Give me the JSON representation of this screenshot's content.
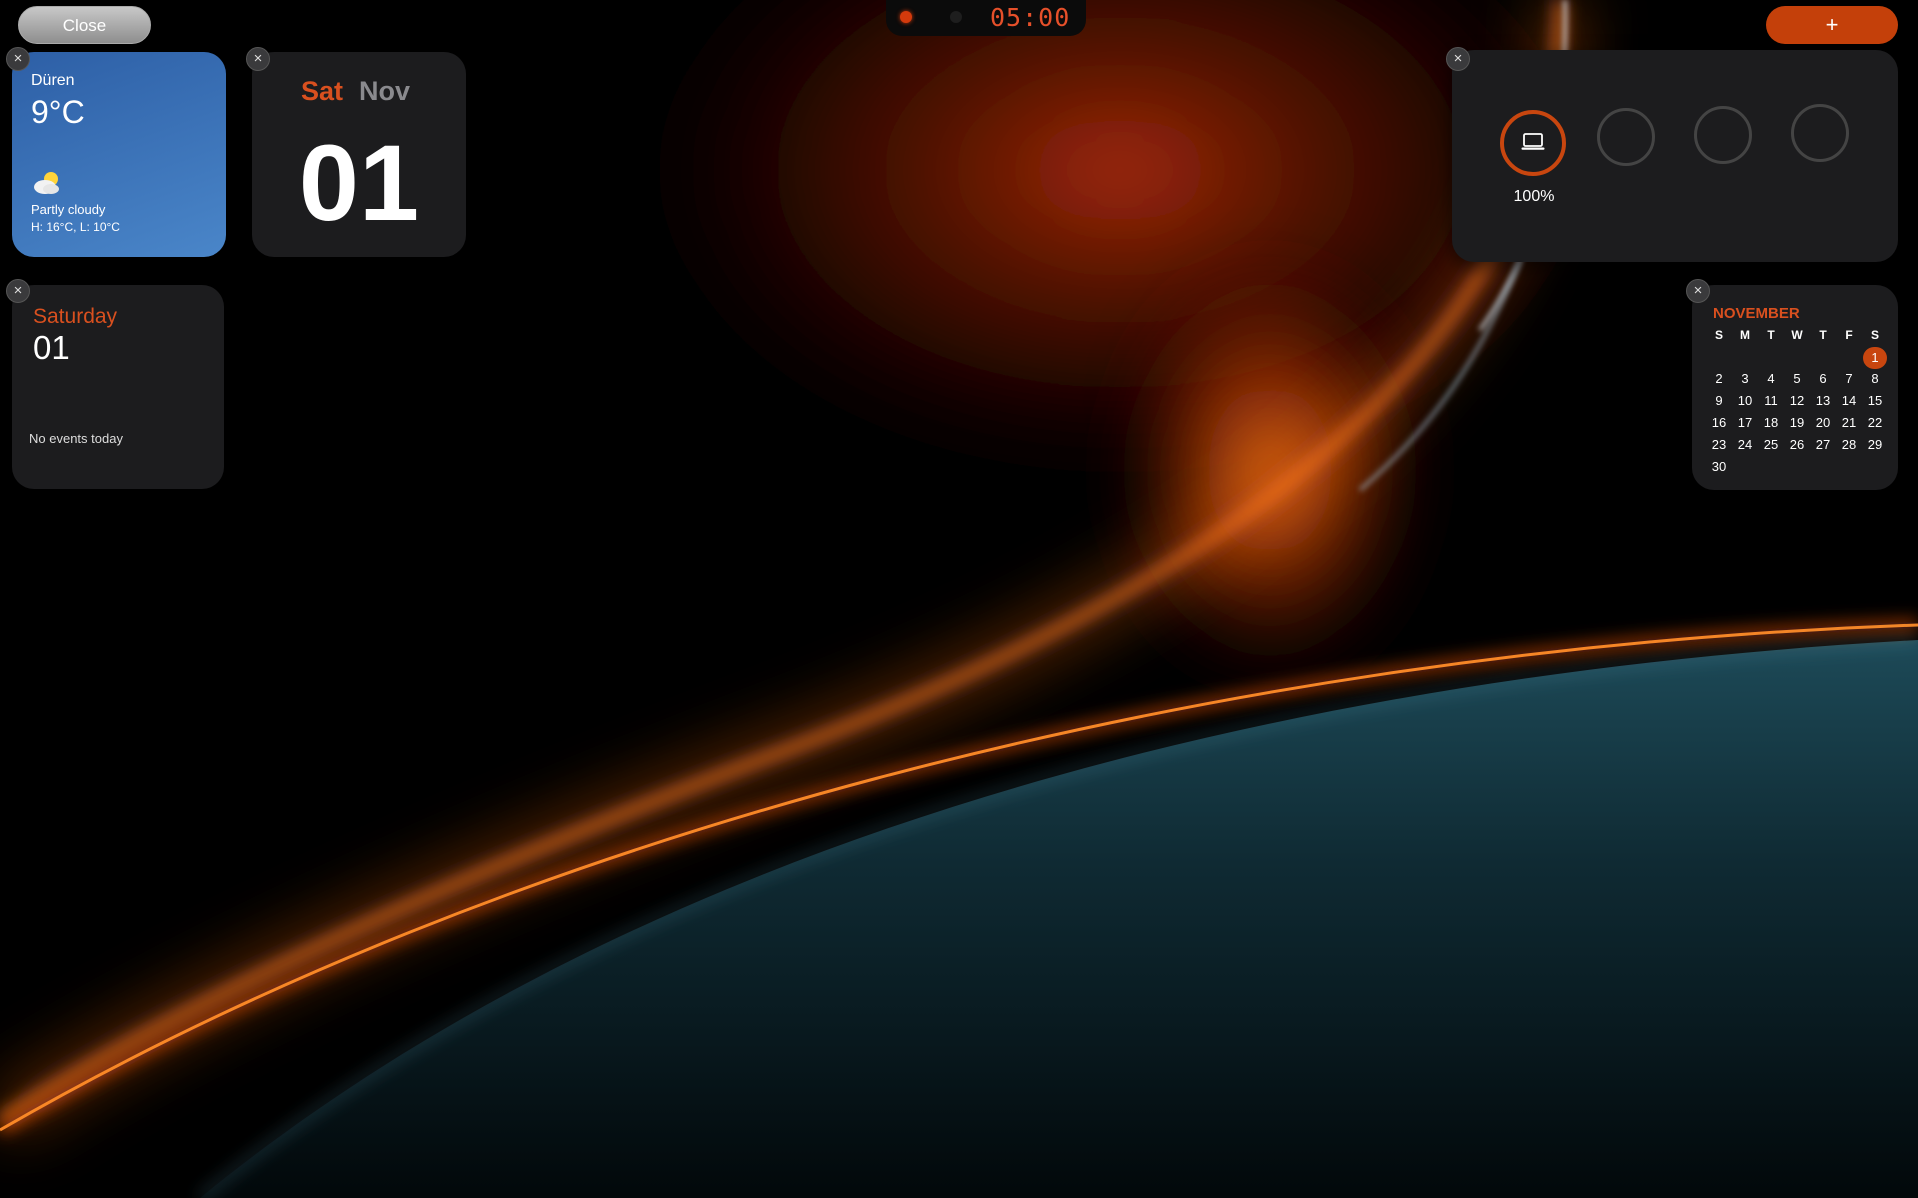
{
  "topbar": {
    "close_label": "Close",
    "add_label": "+",
    "timer": "05:00"
  },
  "colors": {
    "accent": "#d9501f",
    "weather_blue": "#3a73b8",
    "widget_bg": "#1c1c1e"
  },
  "weather": {
    "city": "Düren",
    "temperature": "9°C",
    "condition": "Partly cloudy",
    "high_low": "H: 16°C, L: 10°C",
    "icon": "partly-cloudy-icon"
  },
  "date_tile": {
    "weekday": "Sat",
    "month": "Nov",
    "day": "01"
  },
  "events": {
    "weekday": "Saturday",
    "day": "01",
    "empty_text": "No events today"
  },
  "battery": {
    "devices": [
      {
        "icon": "laptop-icon",
        "level_percent": 100,
        "label": "100%"
      },
      {
        "icon": "empty-slot",
        "level_percent": null
      },
      {
        "icon": "empty-slot",
        "level_percent": null
      },
      {
        "icon": "empty-slot",
        "level_percent": null
      }
    ]
  },
  "calendar": {
    "month": "NOVEMBER",
    "weekdays": [
      "S",
      "M",
      "T",
      "W",
      "T",
      "F",
      "S"
    ],
    "weeks": [
      [
        "",
        "",
        "",
        "",
        "",
        "",
        "1"
      ],
      [
        "2",
        "3",
        "4",
        "5",
        "6",
        "7",
        "8"
      ],
      [
        "9",
        "10",
        "11",
        "12",
        "13",
        "14",
        "15"
      ],
      [
        "16",
        "17",
        "18",
        "19",
        "20",
        "21",
        "22"
      ],
      [
        "23",
        "24",
        "25",
        "26",
        "27",
        "28",
        "29"
      ],
      [
        "30",
        "",
        "",
        "",
        "",
        "",
        ""
      ]
    ],
    "today": "1"
  }
}
